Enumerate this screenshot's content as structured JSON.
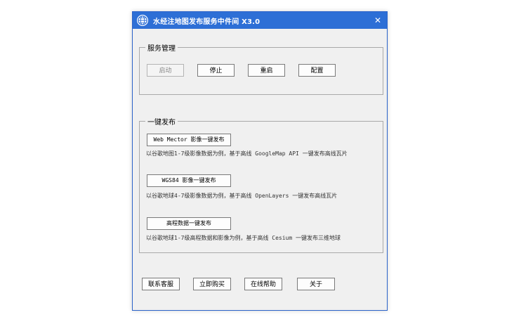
{
  "window": {
    "title": "水经注地图发布服务中件间 X3.0",
    "close_glyph": "✕"
  },
  "service_group": {
    "label": "服务管理",
    "buttons": {
      "start": "启动",
      "stop": "停止",
      "restart": "重启",
      "config": "配置"
    }
  },
  "publish_group": {
    "label": "一键发布",
    "items": [
      {
        "button": "Web Mector 影像一键发布",
        "description": "以谷歌地图1-7级影像数据为例，基于高线 GoogleMap API 一键发布高线瓦片"
      },
      {
        "button": "WGS84 影像一键发布",
        "description": "以谷歌地球4-7级影像数据为例，基于高线 OpenLayers 一键发布高线瓦片"
      },
      {
        "button": "高程数据一键发布",
        "description": "以谷歌地球1-7级高程数据和影像为例，基于高线 Cesium 一键发布三维地球"
      }
    ]
  },
  "footer": {
    "contact": "联系客服",
    "buy": "立即购买",
    "help": "在线帮助",
    "about": "关于"
  },
  "colors": {
    "titlebar": "#2d6fd6",
    "window_bg": "#f0f0f0"
  }
}
